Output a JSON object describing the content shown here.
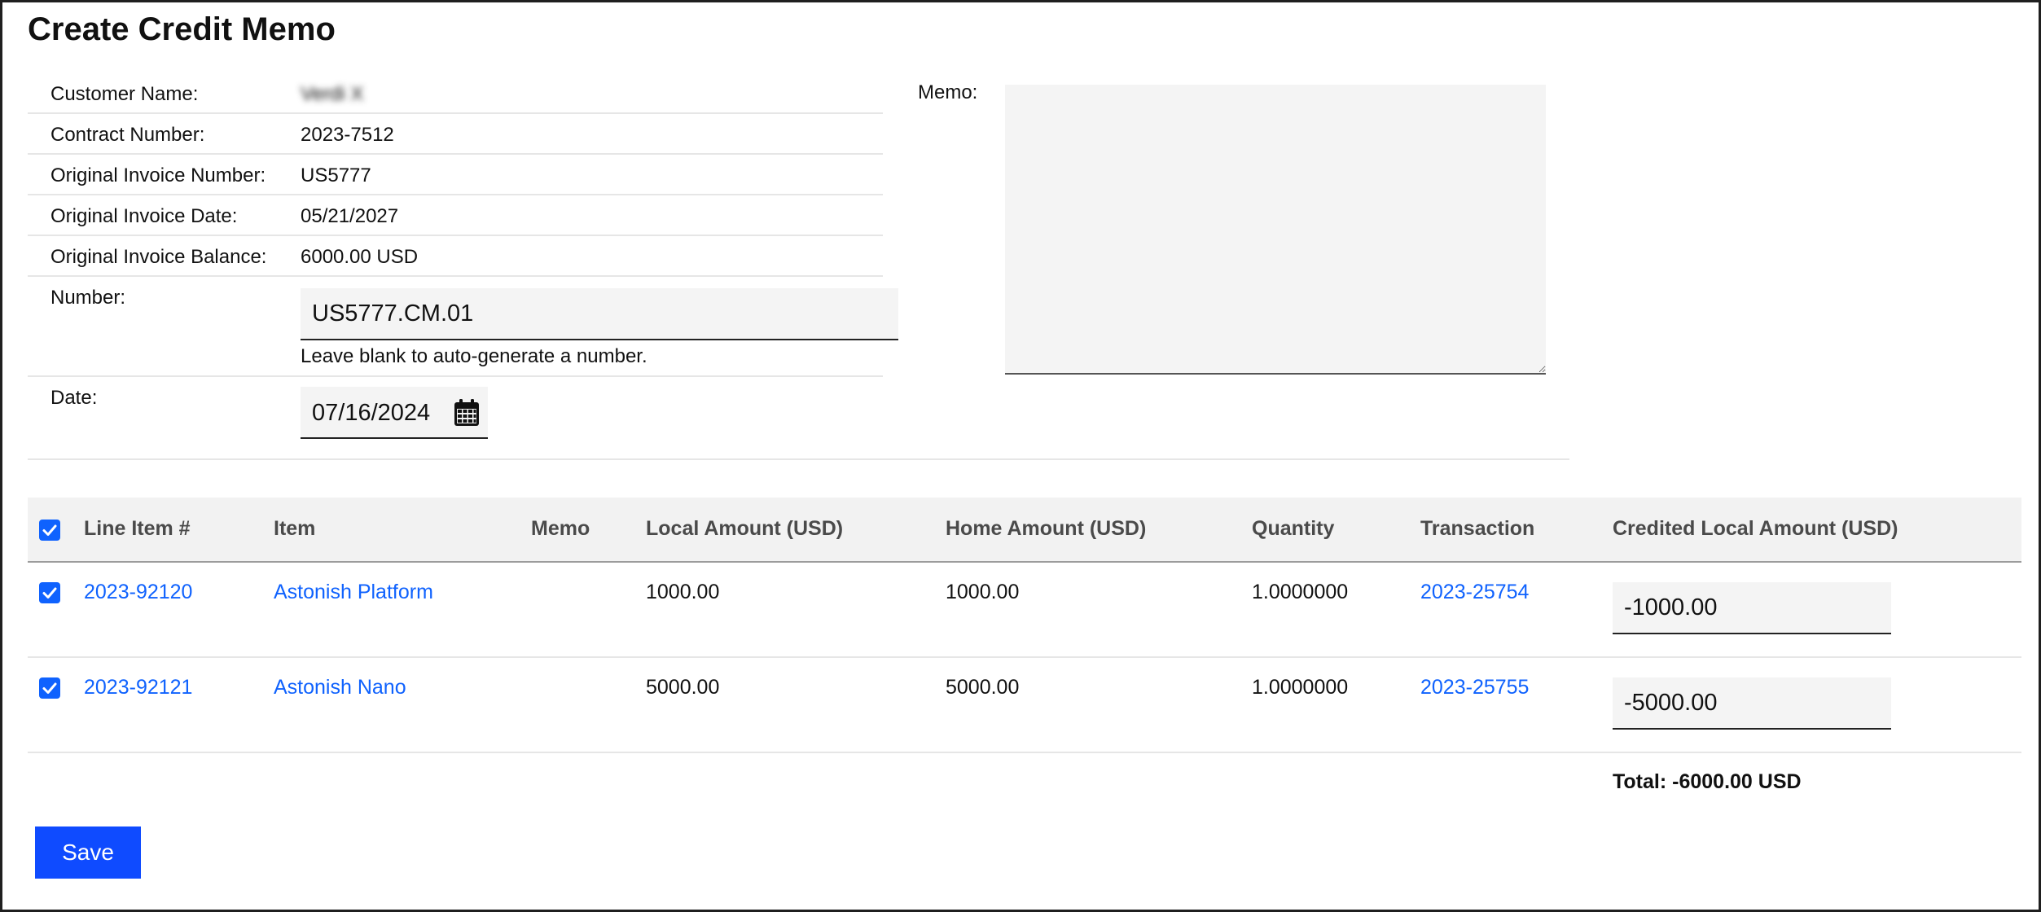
{
  "page": {
    "title": "Create Credit Memo"
  },
  "info": {
    "customer_name_label": "Customer Name:",
    "customer_name_value": "Verdi X",
    "contract_number_label": "Contract Number:",
    "contract_number_value": "2023-7512",
    "orig_invoice_number_label": "Original Invoice Number:",
    "orig_invoice_number_value": "US5777",
    "orig_invoice_date_label": "Original Invoice Date:",
    "orig_invoice_date_value": "05/21/2027",
    "orig_invoice_balance_label": "Original Invoice Balance:",
    "orig_invoice_balance_value": "6000.00 USD",
    "number_label": "Number:",
    "number_value": "US5777.CM.01",
    "number_helper": "Leave blank to auto-generate a number.",
    "date_label": "Date:",
    "date_value": "07/16/2024",
    "calendar_icon": "calendar-icon"
  },
  "memo": {
    "label": "Memo:",
    "value": ""
  },
  "table": {
    "headers": {
      "line_item": "Line Item #",
      "item": "Item",
      "memo": "Memo",
      "local_amount": "Local Amount (USD)",
      "home_amount": "Home Amount (USD)",
      "quantity": "Quantity",
      "transaction": "Transaction",
      "credited_local_amount": "Credited Local Amount (USD)"
    },
    "select_all_checked": true,
    "rows": [
      {
        "checked": true,
        "line_item": "2023-92120",
        "item": "Astonish Platform",
        "memo": "",
        "local_amount": "1000.00",
        "home_amount": "1000.00",
        "quantity": "1.0000000",
        "transaction": "2023-25754",
        "credited_local_amount": "-1000.00"
      },
      {
        "checked": true,
        "line_item": "2023-92121",
        "item": "Astonish Nano",
        "memo": "",
        "local_amount": "5000.00",
        "home_amount": "5000.00",
        "quantity": "1.0000000",
        "transaction": "2023-25755",
        "credited_local_amount": "-5000.00"
      }
    ],
    "total": "Total: -6000.00 USD"
  },
  "actions": {
    "save_label": "Save"
  },
  "colors": {
    "link": "#0f62fe",
    "primary_button": "#0f4bff",
    "checkbox": "#0f62fe"
  }
}
